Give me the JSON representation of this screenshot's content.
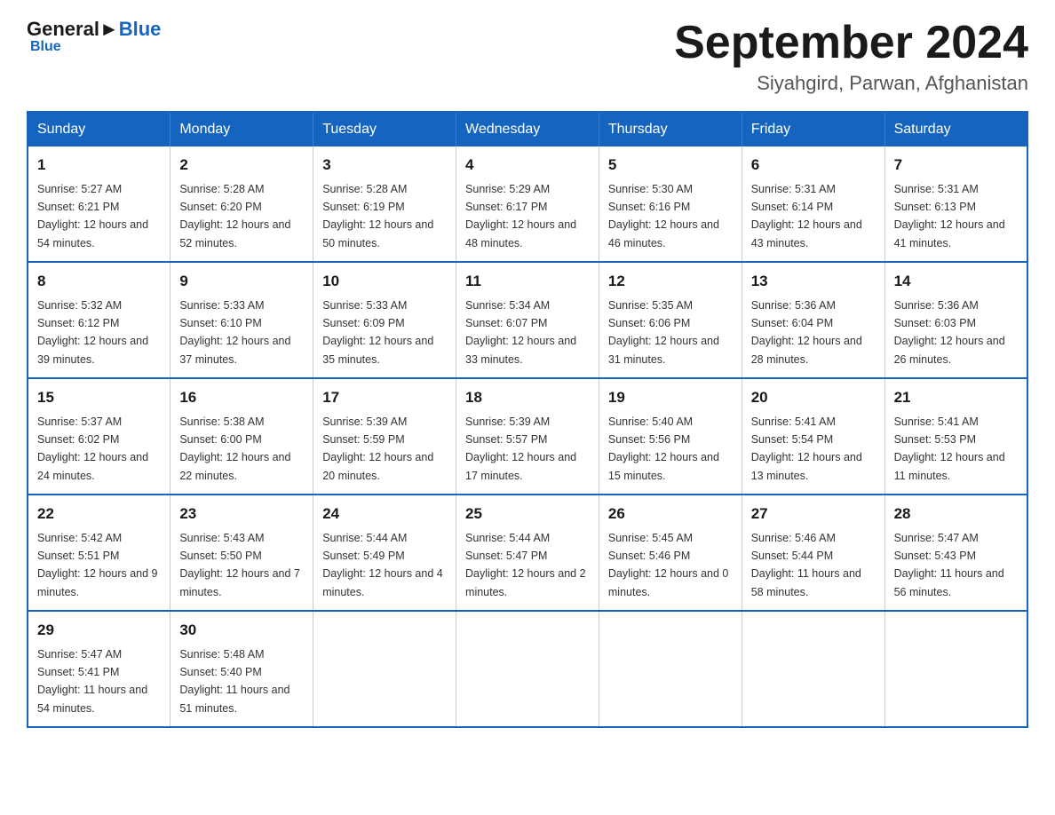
{
  "logo": {
    "general": "General",
    "blue": "Blue",
    "subtitle": "Blue"
  },
  "header": {
    "month": "September 2024",
    "location": "Siyahgird, Parwan, Afghanistan"
  },
  "weekdays": [
    "Sunday",
    "Monday",
    "Tuesday",
    "Wednesday",
    "Thursday",
    "Friday",
    "Saturday"
  ],
  "weeks": [
    [
      {
        "day": "1",
        "sunrise": "Sunrise: 5:27 AM",
        "sunset": "Sunset: 6:21 PM",
        "daylight": "Daylight: 12 hours and 54 minutes."
      },
      {
        "day": "2",
        "sunrise": "Sunrise: 5:28 AM",
        "sunset": "Sunset: 6:20 PM",
        "daylight": "Daylight: 12 hours and 52 minutes."
      },
      {
        "day": "3",
        "sunrise": "Sunrise: 5:28 AM",
        "sunset": "Sunset: 6:19 PM",
        "daylight": "Daylight: 12 hours and 50 minutes."
      },
      {
        "day": "4",
        "sunrise": "Sunrise: 5:29 AM",
        "sunset": "Sunset: 6:17 PM",
        "daylight": "Daylight: 12 hours and 48 minutes."
      },
      {
        "day": "5",
        "sunrise": "Sunrise: 5:30 AM",
        "sunset": "Sunset: 6:16 PM",
        "daylight": "Daylight: 12 hours and 46 minutes."
      },
      {
        "day": "6",
        "sunrise": "Sunrise: 5:31 AM",
        "sunset": "Sunset: 6:14 PM",
        "daylight": "Daylight: 12 hours and 43 minutes."
      },
      {
        "day": "7",
        "sunrise": "Sunrise: 5:31 AM",
        "sunset": "Sunset: 6:13 PM",
        "daylight": "Daylight: 12 hours and 41 minutes."
      }
    ],
    [
      {
        "day": "8",
        "sunrise": "Sunrise: 5:32 AM",
        "sunset": "Sunset: 6:12 PM",
        "daylight": "Daylight: 12 hours and 39 minutes."
      },
      {
        "day": "9",
        "sunrise": "Sunrise: 5:33 AM",
        "sunset": "Sunset: 6:10 PM",
        "daylight": "Daylight: 12 hours and 37 minutes."
      },
      {
        "day": "10",
        "sunrise": "Sunrise: 5:33 AM",
        "sunset": "Sunset: 6:09 PM",
        "daylight": "Daylight: 12 hours and 35 minutes."
      },
      {
        "day": "11",
        "sunrise": "Sunrise: 5:34 AM",
        "sunset": "Sunset: 6:07 PM",
        "daylight": "Daylight: 12 hours and 33 minutes."
      },
      {
        "day": "12",
        "sunrise": "Sunrise: 5:35 AM",
        "sunset": "Sunset: 6:06 PM",
        "daylight": "Daylight: 12 hours and 31 minutes."
      },
      {
        "day": "13",
        "sunrise": "Sunrise: 5:36 AM",
        "sunset": "Sunset: 6:04 PM",
        "daylight": "Daylight: 12 hours and 28 minutes."
      },
      {
        "day": "14",
        "sunrise": "Sunrise: 5:36 AM",
        "sunset": "Sunset: 6:03 PM",
        "daylight": "Daylight: 12 hours and 26 minutes."
      }
    ],
    [
      {
        "day": "15",
        "sunrise": "Sunrise: 5:37 AM",
        "sunset": "Sunset: 6:02 PM",
        "daylight": "Daylight: 12 hours and 24 minutes."
      },
      {
        "day": "16",
        "sunrise": "Sunrise: 5:38 AM",
        "sunset": "Sunset: 6:00 PM",
        "daylight": "Daylight: 12 hours and 22 minutes."
      },
      {
        "day": "17",
        "sunrise": "Sunrise: 5:39 AM",
        "sunset": "Sunset: 5:59 PM",
        "daylight": "Daylight: 12 hours and 20 minutes."
      },
      {
        "day": "18",
        "sunrise": "Sunrise: 5:39 AM",
        "sunset": "Sunset: 5:57 PM",
        "daylight": "Daylight: 12 hours and 17 minutes."
      },
      {
        "day": "19",
        "sunrise": "Sunrise: 5:40 AM",
        "sunset": "Sunset: 5:56 PM",
        "daylight": "Daylight: 12 hours and 15 minutes."
      },
      {
        "day": "20",
        "sunrise": "Sunrise: 5:41 AM",
        "sunset": "Sunset: 5:54 PM",
        "daylight": "Daylight: 12 hours and 13 minutes."
      },
      {
        "day": "21",
        "sunrise": "Sunrise: 5:41 AM",
        "sunset": "Sunset: 5:53 PM",
        "daylight": "Daylight: 12 hours and 11 minutes."
      }
    ],
    [
      {
        "day": "22",
        "sunrise": "Sunrise: 5:42 AM",
        "sunset": "Sunset: 5:51 PM",
        "daylight": "Daylight: 12 hours and 9 minutes."
      },
      {
        "day": "23",
        "sunrise": "Sunrise: 5:43 AM",
        "sunset": "Sunset: 5:50 PM",
        "daylight": "Daylight: 12 hours and 7 minutes."
      },
      {
        "day": "24",
        "sunrise": "Sunrise: 5:44 AM",
        "sunset": "Sunset: 5:49 PM",
        "daylight": "Daylight: 12 hours and 4 minutes."
      },
      {
        "day": "25",
        "sunrise": "Sunrise: 5:44 AM",
        "sunset": "Sunset: 5:47 PM",
        "daylight": "Daylight: 12 hours and 2 minutes."
      },
      {
        "day": "26",
        "sunrise": "Sunrise: 5:45 AM",
        "sunset": "Sunset: 5:46 PM",
        "daylight": "Daylight: 12 hours and 0 minutes."
      },
      {
        "day": "27",
        "sunrise": "Sunrise: 5:46 AM",
        "sunset": "Sunset: 5:44 PM",
        "daylight": "Daylight: 11 hours and 58 minutes."
      },
      {
        "day": "28",
        "sunrise": "Sunrise: 5:47 AM",
        "sunset": "Sunset: 5:43 PM",
        "daylight": "Daylight: 11 hours and 56 minutes."
      }
    ],
    [
      {
        "day": "29",
        "sunrise": "Sunrise: 5:47 AM",
        "sunset": "Sunset: 5:41 PM",
        "daylight": "Daylight: 11 hours and 54 minutes."
      },
      {
        "day": "30",
        "sunrise": "Sunrise: 5:48 AM",
        "sunset": "Sunset: 5:40 PM",
        "daylight": "Daylight: 11 hours and 51 minutes."
      },
      null,
      null,
      null,
      null,
      null
    ]
  ]
}
